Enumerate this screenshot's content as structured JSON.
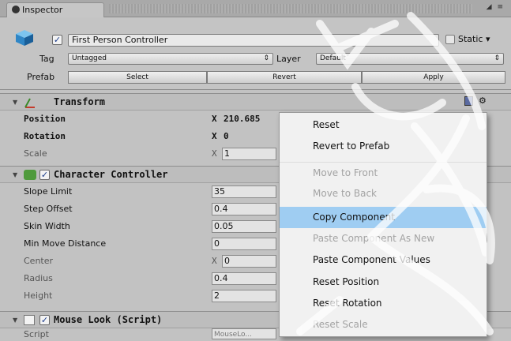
{
  "window": {
    "tab_title": "Inspector",
    "menu_glyph": "◢ ≡"
  },
  "header": {
    "name": "First Person Controller",
    "static_label": "Static ▾",
    "tag_label": "Tag",
    "tag_value": "Untagged",
    "layer_label": "Layer",
    "layer_value": "Default",
    "prefab_label": "Prefab",
    "select_label": "Select",
    "revert_label": "Revert",
    "apply_label": "Apply"
  },
  "transform": {
    "title": "Transform",
    "rows": [
      {
        "label": "Position",
        "axis": "X",
        "value": "210.685"
      },
      {
        "label": "Rotation",
        "axis": "X",
        "value": "0"
      },
      {
        "label": "Scale",
        "axis": "X",
        "value": "1"
      }
    ]
  },
  "character_controller": {
    "title": "Character Controller",
    "rows": [
      {
        "label": "Slope Limit",
        "value": "35"
      },
      {
        "label": "Step Offset",
        "value": "0.4"
      },
      {
        "label": "Skin Width",
        "value": "0.05"
      },
      {
        "label": "Min Move Distance",
        "value": "0"
      },
      {
        "label": "Center",
        "axis": "X",
        "value": "0"
      },
      {
        "label": "Radius",
        "value": "0.4"
      },
      {
        "label": "Height",
        "value": "2"
      }
    ]
  },
  "mouse_look": {
    "title": "Mouse Look (Script)",
    "script_label": "Script",
    "script_value": "MouseLo..."
  },
  "context_menu": {
    "items": [
      {
        "label": "Reset",
        "enabled": true
      },
      {
        "label": "Revert to Prefab",
        "enabled": true
      },
      {
        "label": "Move to Front",
        "enabled": false
      },
      {
        "label": "Move to Back",
        "enabled": false
      },
      {
        "label": "Copy Component",
        "enabled": true,
        "highlighted": true
      },
      {
        "label": "Paste Component As New",
        "enabled": false
      },
      {
        "label": "Paste Component Values",
        "enabled": true
      },
      {
        "label": "Reset Position",
        "enabled": true
      },
      {
        "label": "Reset Rotation",
        "enabled": true
      },
      {
        "label": "Reset Scale",
        "enabled": false
      }
    ]
  },
  "colors": {
    "menu_highlight": "#9fcdf2",
    "panel": "#c4c4c4"
  }
}
